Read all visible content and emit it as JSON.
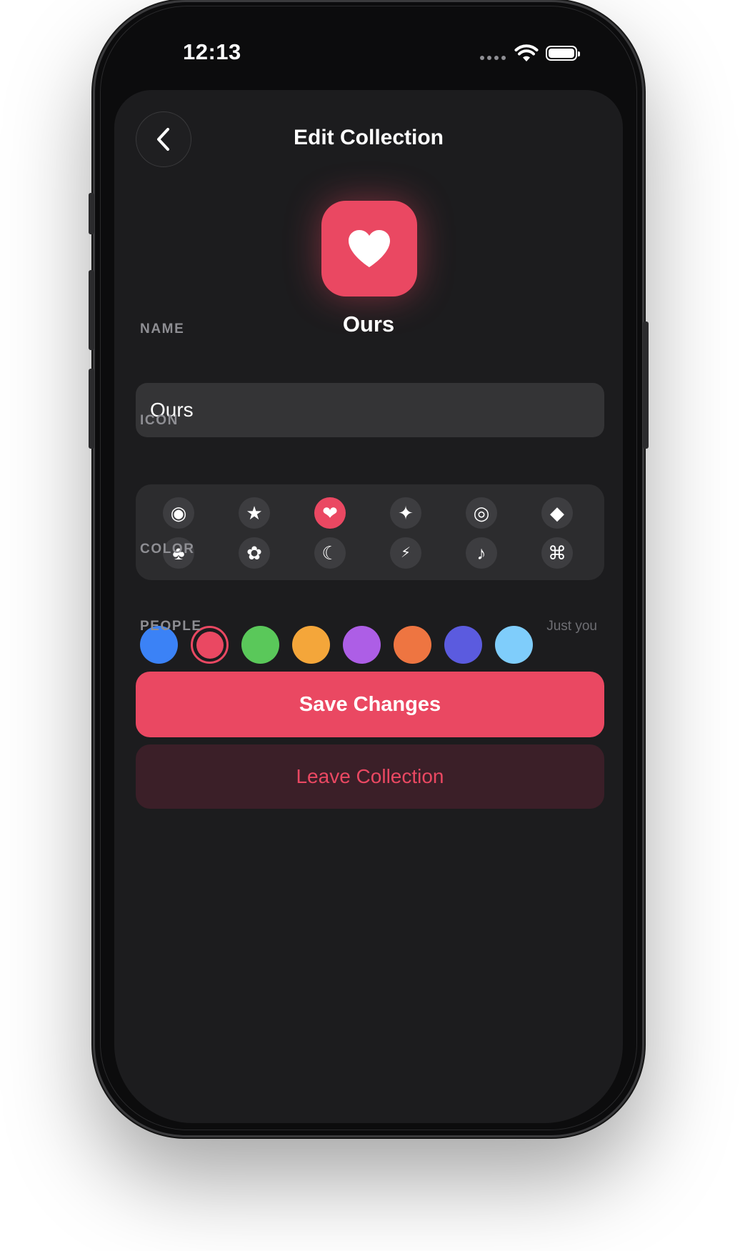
{
  "status_bar": {
    "time": "12:13"
  },
  "nav": {
    "title": "Edit Collection"
  },
  "collection": {
    "name": "Ours",
    "accent_color": "#ea4862"
  },
  "name_section": {
    "label": "NAME",
    "value": "Ours"
  },
  "icon_section": {
    "label": "ICON",
    "icons": [
      {
        "name": "circle-dot-icon",
        "glyph": "◉",
        "selected": false
      },
      {
        "name": "star-icon",
        "glyph": "★",
        "selected": false
      },
      {
        "name": "heart-icon",
        "glyph": "❤",
        "selected": true
      },
      {
        "name": "sparkle-icon",
        "glyph": "✦",
        "selected": false
      },
      {
        "name": "double-circle-icon",
        "glyph": "◎",
        "selected": false
      },
      {
        "name": "diamond-icon",
        "glyph": "◆",
        "selected": false
      },
      {
        "name": "club-icon",
        "glyph": "♣",
        "selected": false
      },
      {
        "name": "flower-icon",
        "glyph": "✿",
        "selected": false
      },
      {
        "name": "moon-icon",
        "glyph": "☾",
        "selected": false
      },
      {
        "name": "bolt-icon",
        "glyph": "⚡",
        "selected": false
      },
      {
        "name": "music-note-icon",
        "glyph": "♪",
        "selected": false
      },
      {
        "name": "command-icon",
        "glyph": "⌘",
        "selected": false
      }
    ]
  },
  "color_section": {
    "label": "COLOR",
    "colors": [
      {
        "hex": "#3b82f6",
        "selected": false
      },
      {
        "hex": "#ea4862",
        "selected": true
      },
      {
        "hex": "#5ac85a",
        "selected": false
      },
      {
        "hex": "#f4a63a",
        "selected": false
      },
      {
        "hex": "#ad5ee6",
        "selected": false
      },
      {
        "hex": "#ee7541",
        "selected": false
      },
      {
        "hex": "#5b5bdf",
        "selected": false
      },
      {
        "hex": "#7fcdfb",
        "selected": false
      }
    ]
  },
  "people_section": {
    "label": "PEOPLE",
    "value": "Just you"
  },
  "actions": {
    "save_label": "Save Changes",
    "leave_label": "Leave Collection"
  }
}
